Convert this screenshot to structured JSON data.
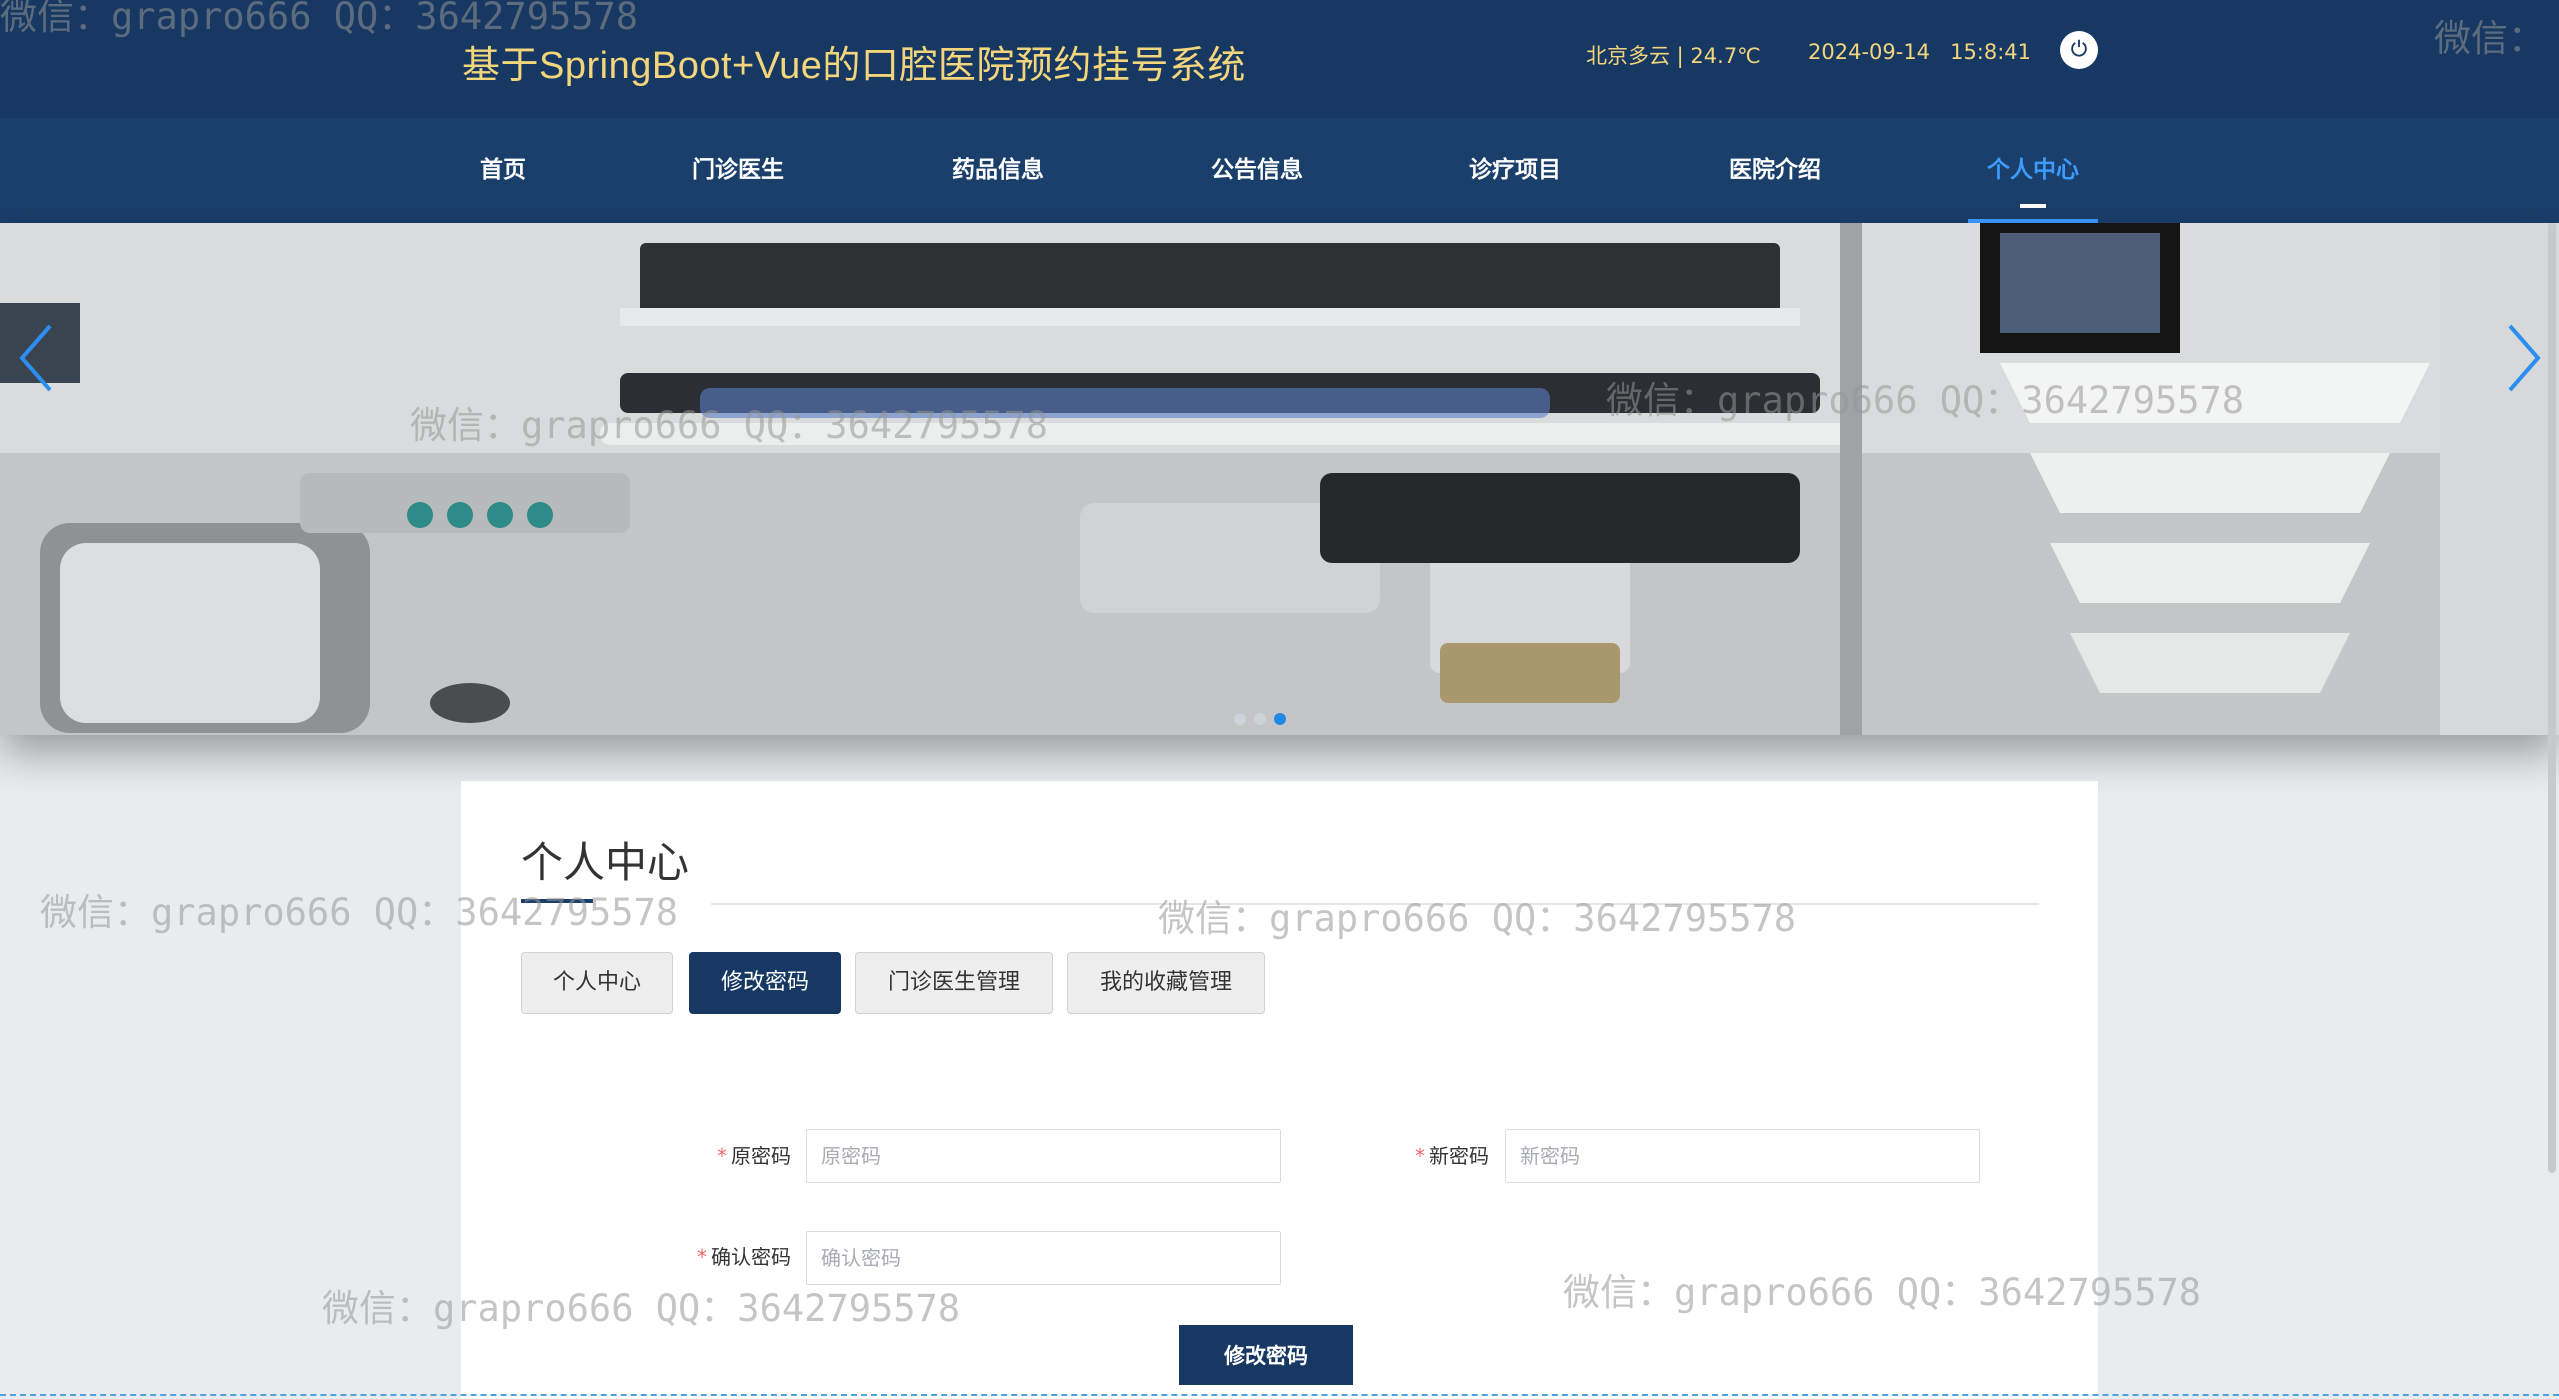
{
  "header": {
    "title": "基于SpringBoot+Vue的口腔医院预约挂号系统",
    "weather": "北京多云 | 24.7℃",
    "date": "2024-09-14",
    "time": "15:8:41",
    "power_icon": "power-icon"
  },
  "nav": {
    "items": [
      {
        "label": "首页"
      },
      {
        "label": "门诊医生"
      },
      {
        "label": "药品信息"
      },
      {
        "label": "公告信息"
      },
      {
        "label": "诊疗项目"
      },
      {
        "label": "医院介绍"
      },
      {
        "label": "个人中心"
      }
    ],
    "active_index": 6
  },
  "banner": {
    "prev_icon": "chevron-left-icon",
    "next_icon": "chevron-right-icon",
    "slide_count": 3,
    "active_slide": 3
  },
  "profile": {
    "title": "个人中心",
    "tabs": [
      {
        "label": "个人中心"
      },
      {
        "label": "修改密码"
      },
      {
        "label": "门诊医生管理"
      },
      {
        "label": "我的收藏管理"
      }
    ],
    "active_tab": 1,
    "form": {
      "old_password": {
        "label": "原密码",
        "placeholder": "原密码",
        "value": ""
      },
      "new_password": {
        "label": "新密码",
        "placeholder": "新密码",
        "value": ""
      },
      "confirm_password": {
        "label": "确认密码",
        "placeholder": "确认密码",
        "value": ""
      },
      "required_mark": "*",
      "submit_label": "修改密码"
    }
  },
  "watermark": {
    "text": "微信：grapro666 QQ：3642795578",
    "short_text": "微信："
  },
  "colors": {
    "header_bg": "#173862",
    "nav_bg": "#1a3f6b",
    "title_gold": "#f3d57c",
    "active_blue": "#3d9bff",
    "required_red": "#f56c6c"
  }
}
